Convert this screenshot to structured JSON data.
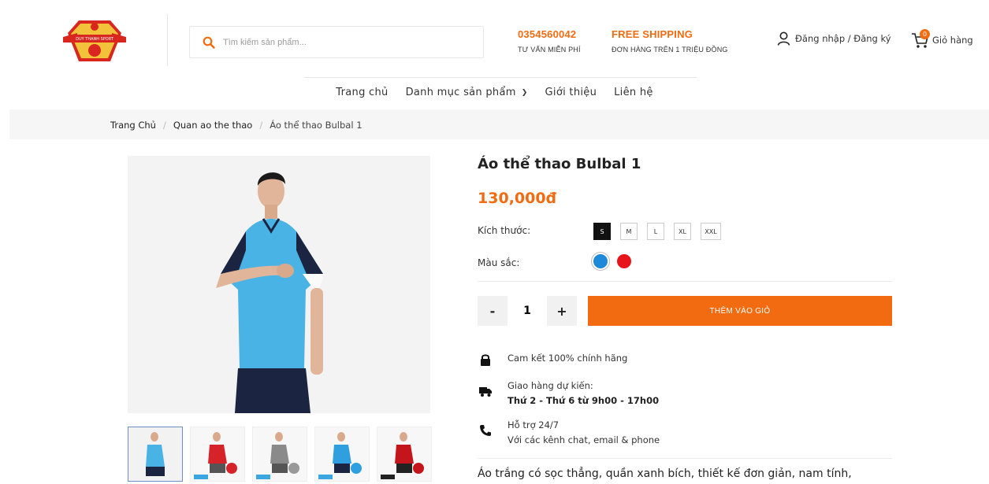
{
  "brand": {
    "logo_text": "DUY THANH SPORT"
  },
  "search": {
    "placeholder": "Tìm kiếm sản phẩm..."
  },
  "header": {
    "phone": "0354560042",
    "phone_sub": "TƯ VẤN MIỄN PHÍ",
    "shipping": "FREE SHIPPING",
    "shipping_sub": "ĐƠN HÀNG TRÊN 1 TRIỆU ĐỒNG",
    "account": "Đăng nhập / Đăng ký",
    "cart": "Giỏ hàng",
    "cart_count": "0"
  },
  "nav": {
    "home": "Trang chủ",
    "categories": "Danh mục sản phẩm",
    "about": "Giới thiệu",
    "contact": "Liên hệ"
  },
  "breadcrumb": {
    "home": "Trang Chủ",
    "category": "Quan ao the thao",
    "current": "Áo thể thao Bulbal 1"
  },
  "product": {
    "title": "Áo thể thao Bulbal 1",
    "price": "130,000đ",
    "size_label": "Kích thước:",
    "sizes": [
      "S",
      "M",
      "L",
      "XL",
      "XXL"
    ],
    "selected_size": "S",
    "color_label": "Màu sắc:",
    "colors": [
      "#1e88d9",
      "#e8141c"
    ],
    "quantity": "1",
    "minus": "-",
    "plus": "+",
    "add_to_cart": "THÊM VÀO GIỎ",
    "description": "Áo trắng có sọc thẳng, quần xanh bích, thiết kế đơn giản, nam tính,"
  },
  "features": {
    "authentic": "Cam kết 100% chính hãng",
    "delivery_title": "Giao hàng dự kiến:",
    "delivery_time": "Thứ 2 - Thứ 6 từ 9h00 - 17h00",
    "support_title": "Hỗ trợ 24/7",
    "support_desc": "Với các kênh chat, email & phone"
  },
  "colors": {
    "accent": "#f36b10",
    "shirt": "#4ab3e6",
    "shorts": "#1b2440"
  }
}
